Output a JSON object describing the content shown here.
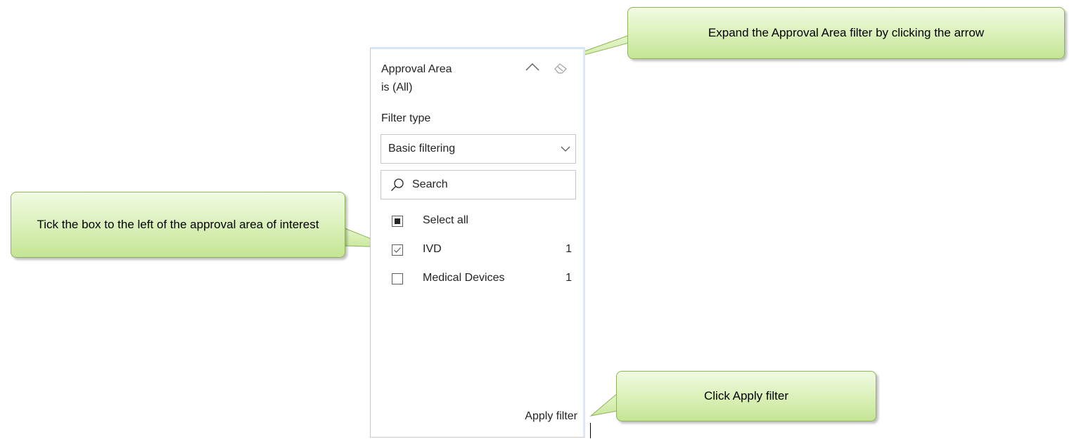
{
  "filter": {
    "title": "Approval Area",
    "subtitle": "is (All)",
    "filter_type_label": "Filter type",
    "filter_type_value": "Basic filtering",
    "search_placeholder": "Search",
    "select_all": {
      "label": "Select all",
      "state": "partial"
    },
    "items": [
      {
        "label": "IVD",
        "count": "1",
        "checked": true
      },
      {
        "label": "Medical Devices",
        "count": "1",
        "checked": false
      }
    ],
    "apply_label": "Apply filter"
  },
  "callouts": {
    "expand": "Expand the Approval Area filter by clicking the arrow",
    "tick": "Tick the box to the left of the approval area of interest",
    "apply": "Click Apply filter"
  },
  "colors": {
    "callout_border": "#8fb45a",
    "callout_fill": "#d9f0b7",
    "text": "#252423",
    "border": "#c8c8c8"
  }
}
